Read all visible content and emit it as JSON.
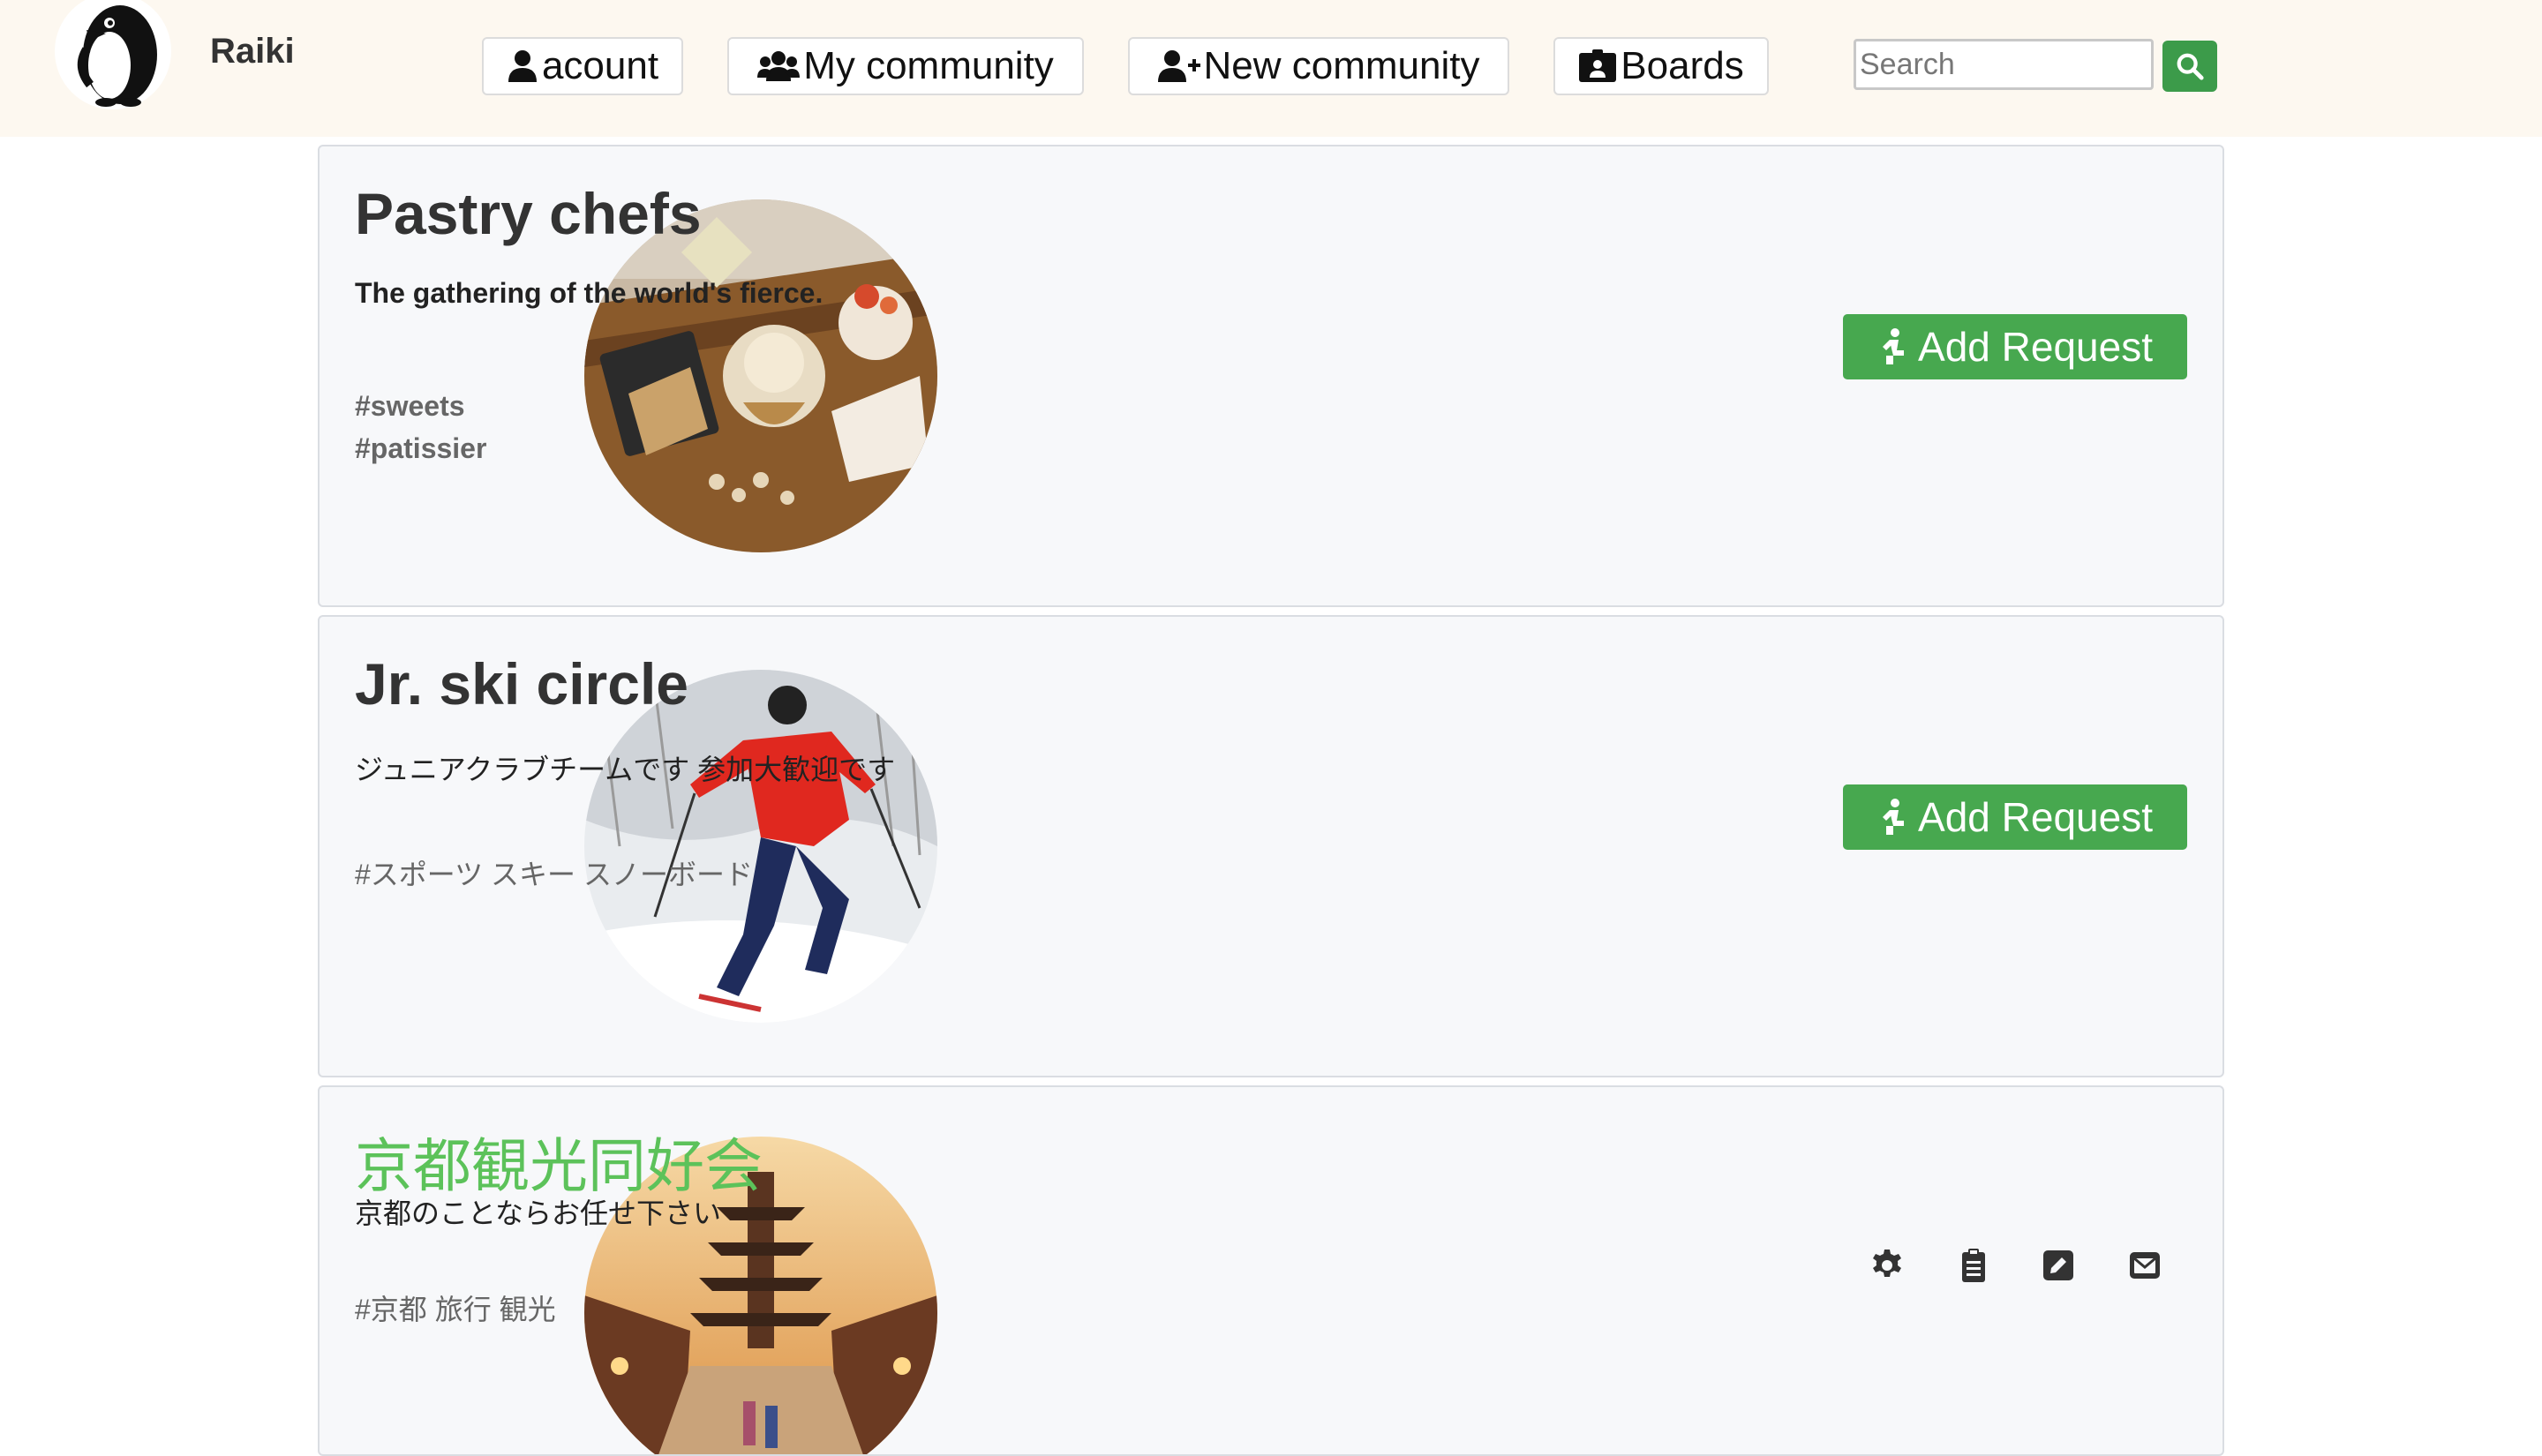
{
  "header": {
    "brand": "Raiki",
    "logo_icon": "penguin-logo-icon",
    "nav": [
      {
        "label": "acount",
        "icon": "user-icon"
      },
      {
        "label": "My community",
        "icon": "users-icon"
      },
      {
        "label": "New community",
        "icon": "user-plus-icon"
      },
      {
        "label": "Boards",
        "icon": "id-card-icon"
      }
    ],
    "search": {
      "placeholder": "Search",
      "value": "",
      "button_icon": "search-icon"
    }
  },
  "colors": {
    "navbar_bg": "#fdf8f0",
    "accent_green": "#47a84f",
    "title_green": "#5cc25a",
    "card_bg": "#f7f8fa"
  },
  "communities": [
    {
      "title": "Pastry chefs",
      "description": "The gathering of the world's fierce.",
      "tags": [
        "#sweets",
        "#patissier"
      ],
      "image": "pastry-photo",
      "action_label": "Add Request"
    },
    {
      "title": "Jr. ski circle",
      "description": "ジュニアクラブチームです 参加大歓迎です",
      "tags": [
        "#スポーツ スキー スノーボード"
      ],
      "image": "skier-photo",
      "action_label": "Add Request"
    },
    {
      "title": "京都観光同好会",
      "description": "京都のことならお任せ下さい",
      "tags": [
        "#京都 旅行 観光"
      ],
      "image": "kyoto-pagoda-photo",
      "action_icons": [
        "gear-icon",
        "clipboard-list-icon",
        "edit-icon",
        "envelope-icon"
      ]
    }
  ]
}
